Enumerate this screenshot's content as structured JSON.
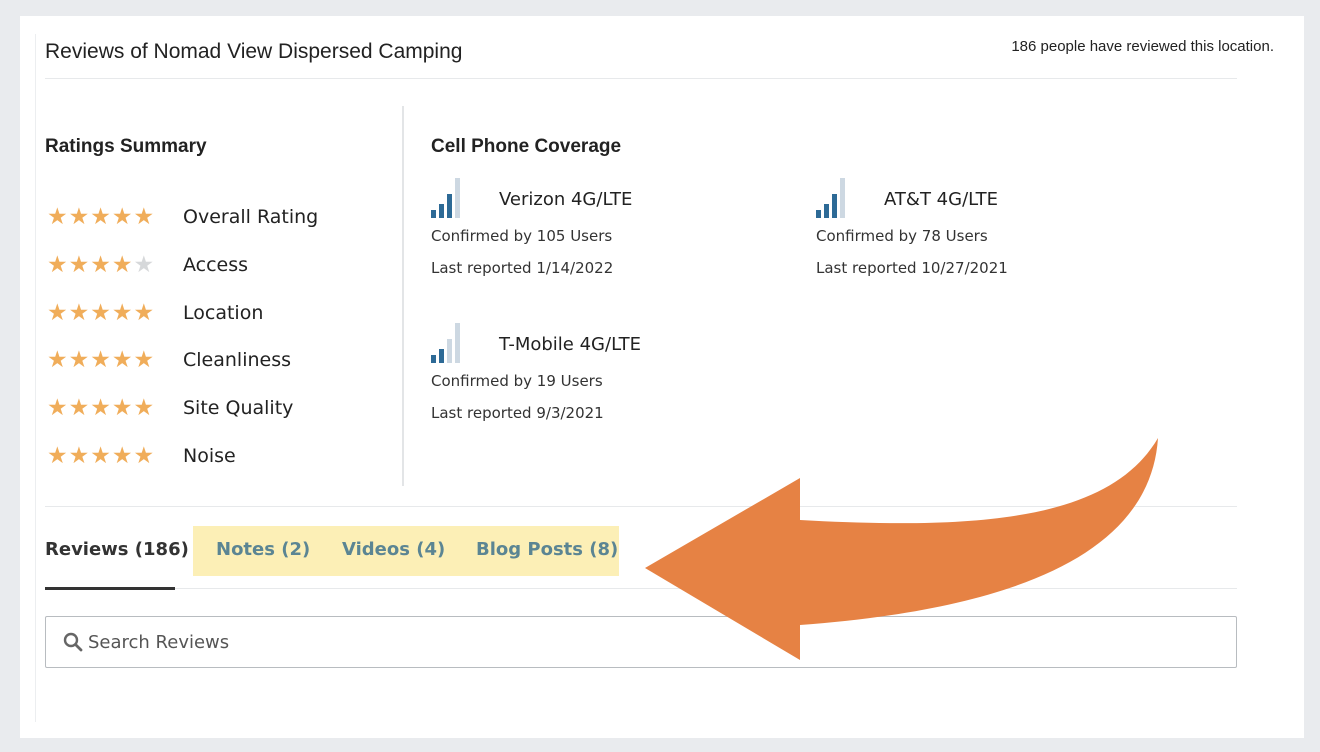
{
  "header": {
    "title": "Reviews of Nomad View Dispersed Camping",
    "review_count_text": "186 people have reviewed this location."
  },
  "ratings": {
    "title": "Ratings Summary",
    "items": [
      {
        "label": "Overall Rating",
        "stars": 5
      },
      {
        "label": "Access",
        "stars": 4
      },
      {
        "label": "Location",
        "stars": 5
      },
      {
        "label": "Cleanliness",
        "stars": 5
      },
      {
        "label": "Site Quality",
        "stars": 5
      },
      {
        "label": "Noise",
        "stars": 5
      }
    ],
    "max_stars": 5
  },
  "coverage": {
    "title": "Cell Phone Coverage",
    "carriers": [
      {
        "name": "Verizon 4G/LTE",
        "confirmed": "Confirmed by 105 Users",
        "last": "Last reported 1/14/2022",
        "signal_bars": 3,
        "max_bars": 4
      },
      {
        "name": "AT&T 4G/LTE",
        "confirmed": "Confirmed by 78 Users",
        "last": "Last reported 10/27/2021",
        "signal_bars": 3,
        "max_bars": 4
      },
      {
        "name": "T-Mobile 4G/LTE",
        "confirmed": "Confirmed by 19 Users",
        "last": "Last reported 9/3/2021",
        "signal_bars": 2,
        "max_bars": 4
      }
    ]
  },
  "tabs": [
    {
      "label": "Reviews (186)",
      "active": true
    },
    {
      "label": "Notes (2)",
      "active": false
    },
    {
      "label": "Videos (4)",
      "active": false
    },
    {
      "label": "Blog Posts (8)",
      "active": false
    }
  ],
  "search": {
    "placeholder": "Search Reviews",
    "value": ""
  },
  "colors": {
    "star_on": "#f0ad5a",
    "star_off": "#d6d8da",
    "signal_on": "#2d6a96",
    "signal_off": "#cdd8e2",
    "tab_link": "#5b8593",
    "tab_highlight": "#fcefb6",
    "arrow": "#e68244"
  }
}
